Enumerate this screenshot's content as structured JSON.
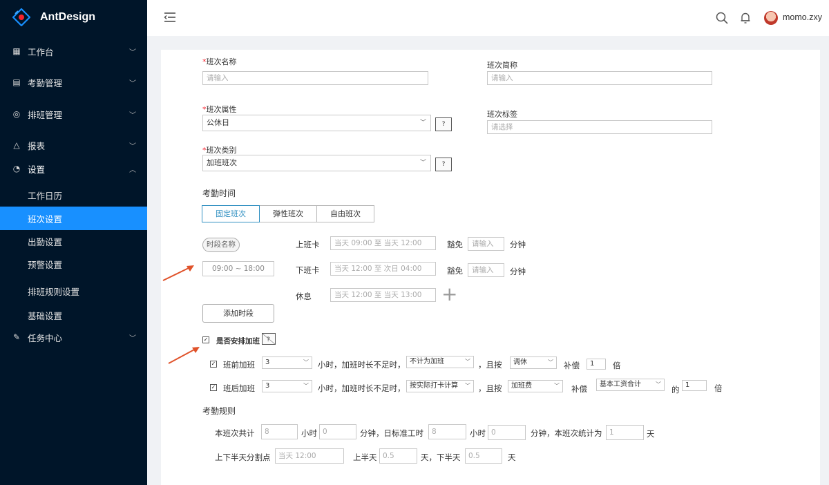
{
  "app": {
    "name": "AntDesign"
  },
  "sidebar": {
    "items": [
      {
        "label": "工作台",
        "icon": "table-icon"
      },
      {
        "label": "考勤管理",
        "icon": "file-icon"
      },
      {
        "label": "排班管理",
        "icon": "check-circle-icon"
      },
      {
        "label": "报表",
        "icon": "warning-icon"
      },
      {
        "label": "设置",
        "icon": "dashboard-icon"
      }
    ],
    "settings_sub": [
      "工作日历",
      "班次设置",
      "出勤设置",
      "预警设置",
      "排班规则设置",
      "基础设置"
    ],
    "task_center": "任务中心"
  },
  "header": {
    "username": "momo.zxy"
  },
  "form": {
    "shift_name_label": "班次名称",
    "shift_name_placeholder": "请输入",
    "shift_abbr_label": "班次简称",
    "shift_abbr_placeholder": "请输入",
    "shift_attr_label": "班次属性",
    "shift_attr_value": "公休日",
    "shift_tag_label": "班次标签",
    "shift_tag_placeholder": "请选择",
    "shift_type_label": "班次类别",
    "shift_type_value": "加班班次",
    "help_glyph": "?",
    "attendance_time_title": "考勤时间",
    "tabs": [
      "固定班次",
      "弹性班次",
      "自由班次"
    ],
    "period_name_placeholder": "时段名称",
    "period_time": "09:00 ~ 18:00",
    "clock_in_label": "上班卡",
    "clock_in_value": "当天 09:00  至  当天 12:00",
    "clock_out_label": "下班卡",
    "clock_out_value": "当天 12:00  至  次日 04:00",
    "exempt_label": "豁免",
    "exempt_placeholder": "请输入",
    "minutes_label": "分钟",
    "rest_label": "休息",
    "rest_value": "当天 12:00  至  当天 13:00",
    "plus_glyph": "+",
    "add_period_button": "添加时段",
    "overtime_toggle_label": "是否安排加班",
    "pre_ot_label": "班前加班",
    "pre_ot_hours": "3",
    "hours_not_enough": "小时，加班时长不足时，",
    "pre_ot_rule": "不计为加班",
    "and_by": "，且按",
    "pre_ot_comp": "调休",
    "compensate": "补偿",
    "pre_ot_times": "1",
    "times": "倍",
    "post_ot_label": "班后加班",
    "post_ot_hours": "3",
    "post_ot_rule": "按实际打卡计算",
    "post_ot_comp": "加班费",
    "post_ot_base": "基本工资合计",
    "of": "的",
    "post_ot_times": "1",
    "rules_title": "考勤规则",
    "total_label": "本班次共计",
    "total_hours": "8",
    "hour_unit": "小时",
    "total_minutes": "0",
    "std_label": "分钟，日标准工时",
    "std_hours": "8",
    "std_minutes": "0",
    "count_label": "分钟，本班次统计为",
    "count_days": "1",
    "day_unit": "天",
    "split_label": "上下半天分割点",
    "split_value": "当天 12:00",
    "first_half_label": "上半天",
    "first_half": "0.5",
    "second_half_label": "天，下半天",
    "second_half": "0.5"
  },
  "colors": {
    "sidebar_bg": "#001529",
    "active": "#1890ff",
    "arrow": "#e0522a"
  }
}
